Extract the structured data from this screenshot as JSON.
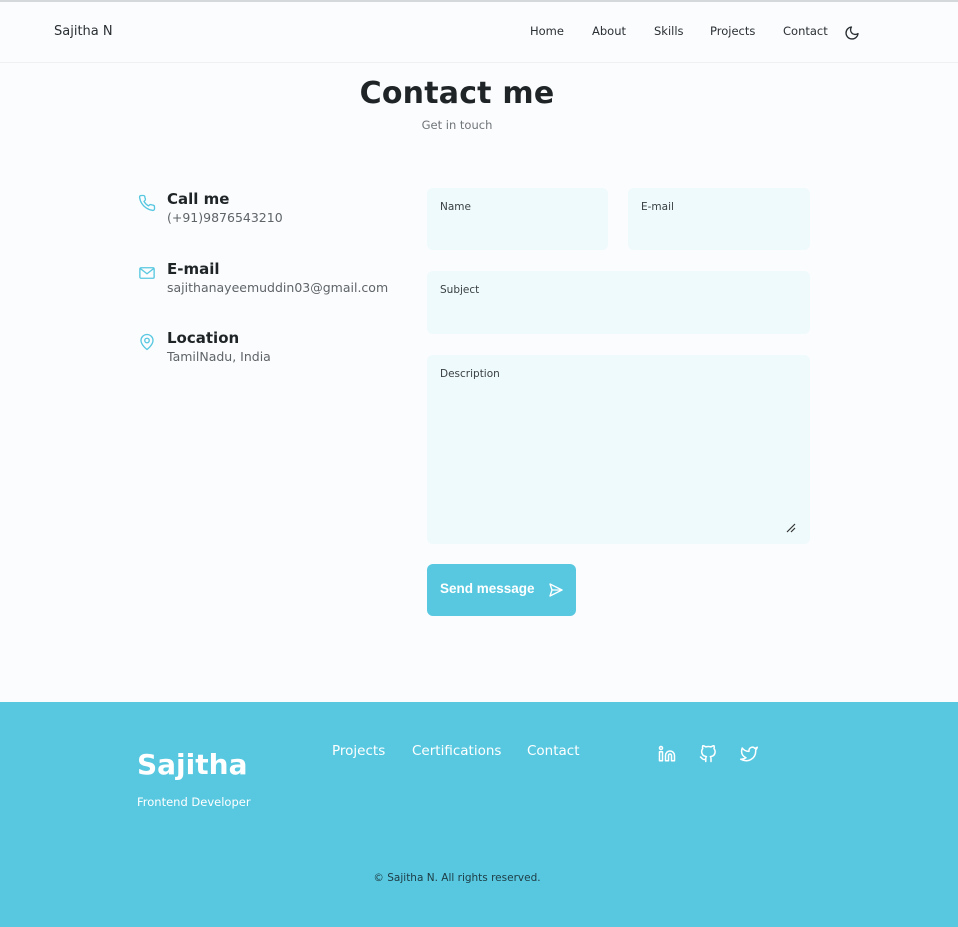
{
  "header": {
    "brand": "Sajitha N",
    "nav": [
      {
        "label": "Home"
      },
      {
        "label": "About"
      },
      {
        "label": "Skills"
      },
      {
        "label": "Projects"
      },
      {
        "label": "Contact"
      }
    ],
    "theme_icon": "moon-icon"
  },
  "contact": {
    "title": "Contact me",
    "subtitle": "Get in touch",
    "info": [
      {
        "icon": "phone-icon",
        "title": "Call me",
        "value": "(+91)9876543210"
      },
      {
        "icon": "mail-icon",
        "title": "E-mail",
        "value": "sajithanayeemuddin03@gmail.com"
      },
      {
        "icon": "location-icon",
        "title": "Location",
        "value": "TamilNadu, India"
      }
    ]
  },
  "form": {
    "name_label": "Name",
    "email_label": "E-mail",
    "subject_label": "Subject",
    "description_label": "Description",
    "name_value": "",
    "email_value": "",
    "subject_value": "",
    "description_value": "",
    "send_label": "Send message",
    "send_icon": "send-icon"
  },
  "footer": {
    "name": "Sajitha",
    "role": "Frontend Developer",
    "links": [
      "Projects",
      "Certifications",
      "Contact"
    ],
    "social": [
      "linkedin-icon",
      "github-icon",
      "twitter-icon"
    ],
    "copyright": "© Sajitha N. All rights reserved."
  },
  "colors": {
    "accent": "#58c8e0",
    "field_bg": "#eefafb",
    "page_bg": "#fbfcfe",
    "text": "#1f2426"
  }
}
